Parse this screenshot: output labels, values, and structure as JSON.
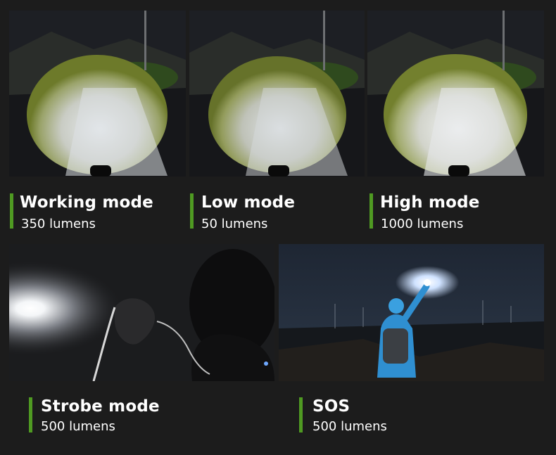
{
  "modes": [
    {
      "title": "Working mode",
      "lumens": "350 lumens"
    },
    {
      "title": "Low mode",
      "lumens": "50 lumens"
    },
    {
      "title": "High mode",
      "lumens": "1000 lumens"
    },
    {
      "title": "Strobe mode",
      "lumens": "500 lumens"
    },
    {
      "title": "SOS",
      "lumens": "500 lumens"
    }
  ],
  "colors": {
    "background": "#1c1c1c",
    "accent_bar": "#4f9a22",
    "text": "#ffffff"
  }
}
